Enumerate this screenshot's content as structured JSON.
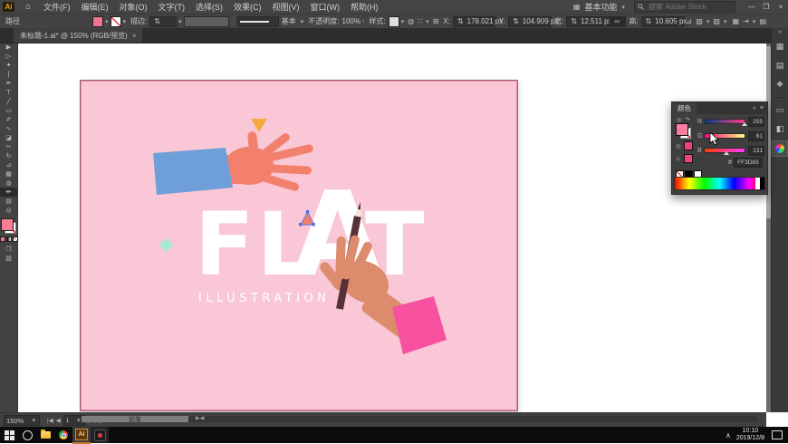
{
  "menubar": {
    "app": "Ai",
    "items": [
      "文件(F)",
      "编辑(E)",
      "对象(O)",
      "文字(T)",
      "选择(S)",
      "效果(C)",
      "视图(V)",
      "窗口(W)",
      "帮助(H)"
    ],
    "workspace": "基本功能"
  },
  "search": {
    "placeholder": "搜索 Adobe Stock"
  },
  "icons": {
    "chevron_down": "▾",
    "chevron_right": "›",
    "double_right": "»",
    "double_left": "«",
    "panel_menu": "≡",
    "minimize": "—",
    "maximize": "❐",
    "close": "×",
    "home": "⌂",
    "updown": "⇅",
    "link": "∞",
    "recolor": "◍",
    "align": "∷",
    "transform_grid": "⊞",
    "shear": "⊿",
    "shape_mode": "▧",
    "expand_style": "▨",
    "opt_right_1": "▦",
    "opt_right_2": "⇥",
    "opt_right_3": "▤",
    "swap": "↷",
    "warning": "⚠",
    "gamut": "◎",
    "nav_first": "|◀",
    "nav_prev": "◀",
    "nav_next": "▶",
    "nav_last": "▶|",
    "scroll_arrows": "▶◀",
    "chevron_up": "∧"
  },
  "options_bar": {
    "selection_type": "路径",
    "stroke_label": "描边:",
    "brush_definition": "基本",
    "opacity_label": "不透明度:",
    "opacity_value": "100%",
    "style_label": "样式:",
    "x_label": "X:",
    "x_value": "178.021 px",
    "y_label": "Y:",
    "y_value": "104.909 px",
    "w_label": "宽:",
    "w_value": "12.511 px",
    "h_label": "高:",
    "h_value": "10.605 px"
  },
  "document_tab": {
    "title": "未标题-1.ai* @ 150% (RGB/预览)"
  },
  "toolbar": {
    "tools": [
      {
        "name": "selection",
        "glyph": "▶"
      },
      {
        "name": "direct-selection",
        "glyph": "▷"
      },
      {
        "name": "magic-wand",
        "glyph": "✦"
      },
      {
        "name": "lasso",
        "glyph": "ʃ"
      },
      {
        "name": "pen",
        "glyph": "✒"
      },
      {
        "name": "type",
        "glyph": "T"
      },
      {
        "name": "line-segment",
        "glyph": "╱"
      },
      {
        "name": "rectangle",
        "glyph": "▭"
      },
      {
        "name": "paintbrush",
        "glyph": "✐"
      },
      {
        "name": "shaper",
        "glyph": "∿"
      },
      {
        "name": "eraser",
        "glyph": "◪"
      },
      {
        "name": "scissors",
        "glyph": "✂"
      },
      {
        "name": "rotate",
        "glyph": "↻"
      },
      {
        "name": "scale",
        "glyph": "⊿"
      },
      {
        "name": "free-transform",
        "glyph": "▦"
      },
      {
        "name": "shape-builder",
        "glyph": "◍"
      },
      {
        "name": "pencil",
        "glyph": "✏"
      },
      {
        "name": "mesh",
        "glyph": "▤"
      },
      {
        "name": "zoom",
        "glyph": "◎"
      }
    ]
  },
  "artwork": {
    "headline_fl": "FL",
    "headline_a": "A",
    "headline_t": "T",
    "subtitle": "ILLUSTRATION"
  },
  "color_panel": {
    "tab": "颜色",
    "sliders": [
      {
        "label": "R",
        "value": "255"
      },
      {
        "label": "G",
        "value": "61"
      },
      {
        "label": "B",
        "value": "131"
      }
    ],
    "hex_prefix": "#",
    "hex": "FF3D83"
  },
  "right_dock": {
    "icons": [
      {
        "name": "transform",
        "glyph": "▦"
      },
      {
        "name": "swatches",
        "glyph": "▤"
      },
      {
        "name": "symbols",
        "glyph": "❖"
      },
      {
        "name": "artboards",
        "glyph": "▭"
      },
      {
        "name": "layers",
        "glyph": "◧"
      }
    ]
  },
  "status_bar": {
    "zoom": "150%",
    "artboard_number": "1",
    "tool_status": "铅笔"
  },
  "taskbar": {
    "time": "10:10",
    "date": "2019/12/8"
  },
  "colors": {
    "artboard_pink": "#F9C7D5",
    "fill_swatch_pink": "#F2758D",
    "selected_rgb_hex": "#FF3D83",
    "hand_coral": "#F2806D",
    "sleeve_blue": "#6E9FD9",
    "hand_tan": "#DC8C6C",
    "sleeve_pink": "#F8519F",
    "triangle_yellow": "#F6A93D",
    "diamond_mint": "#A7EAD3",
    "pencil_body": "#573138",
    "headline_white": "#FFFFFF"
  }
}
